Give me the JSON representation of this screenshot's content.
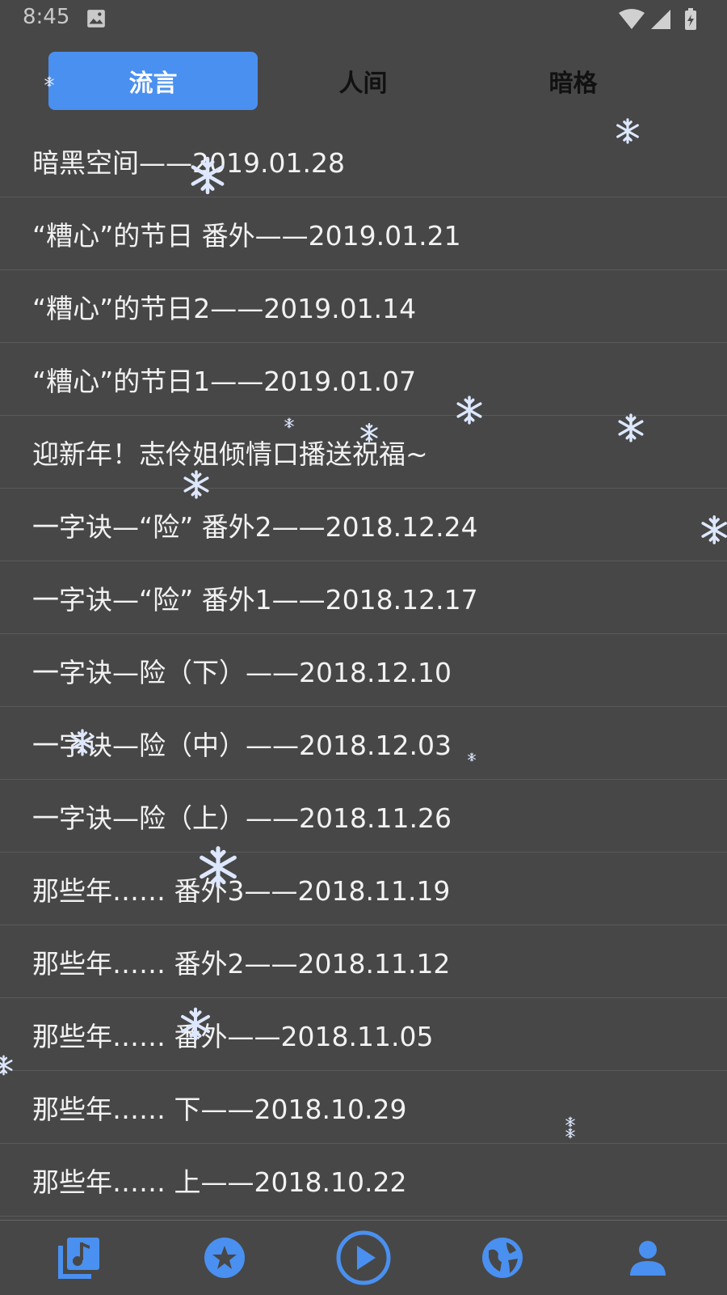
{
  "status_bar": {
    "time": "8:45"
  },
  "tabs": [
    {
      "label": "流言",
      "active": true
    },
    {
      "label": "人间",
      "active": false
    },
    {
      "label": "暗格",
      "active": false
    }
  ],
  "list_items": [
    "暗黑空间——2019.01.28",
    "“糟心”的节日 番外——2019.01.21",
    "“糟心”的节日2——2019.01.14",
    "“糟心”的节日1——2019.01.07",
    "迎新年！志伶姐倾情口播送祝福~",
    "一字诀—“险” 番外2——2018.12.24",
    "一字诀—“险” 番外1——2018.12.17",
    "一字诀—险（下）——2018.12.10",
    "一字诀—险（中）——2018.12.03",
    "一字诀—险（上）——2018.11.26",
    "那些年…… 番外3——2018.11.19",
    "那些年…… 番外2——2018.11.12",
    "那些年…… 番外——2018.11.05",
    "那些年…… 下——2018.10.29",
    "那些年…… 上——2018.10.22"
  ],
  "bottom_nav": [
    {
      "icon": "music-library-icon"
    },
    {
      "icon": "star-icon"
    },
    {
      "icon": "play-icon"
    },
    {
      "icon": "globe-icon"
    },
    {
      "icon": "profile-icon"
    }
  ],
  "colors": {
    "accent": "#4a90f0",
    "background": "#474747",
    "text": "#f2f2f2"
  }
}
